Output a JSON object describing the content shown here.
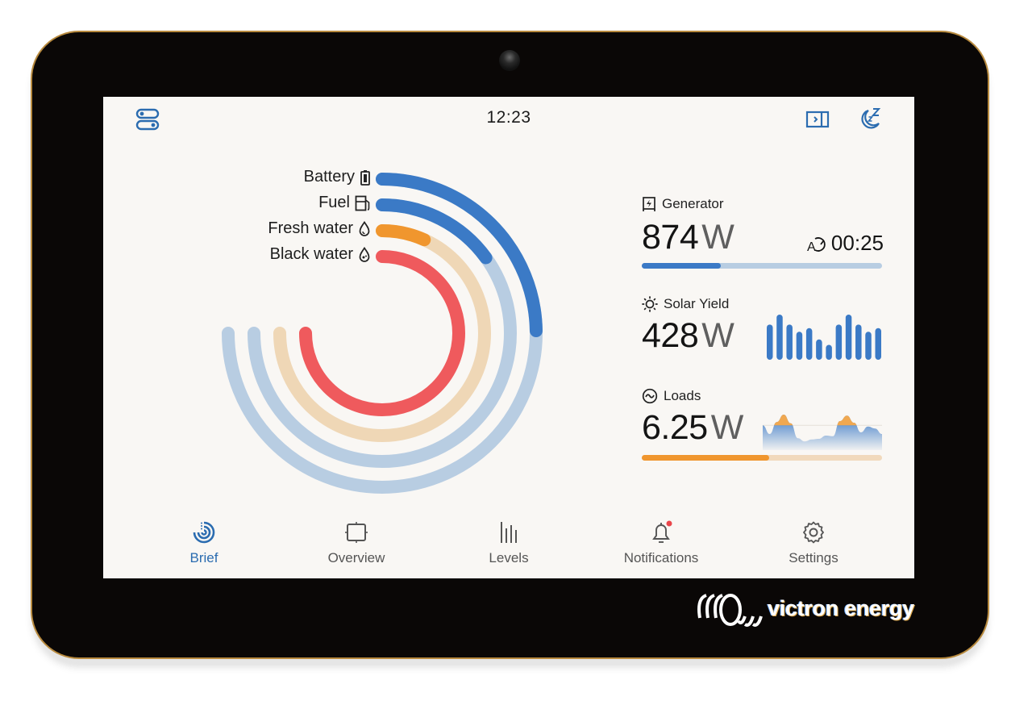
{
  "brand": {
    "name": "victron energy"
  },
  "header": {
    "time": "12:23",
    "left_icon": "toggles-icon",
    "right_icons": [
      "sidebar-toggle-icon",
      "sleep-moon-icon"
    ]
  },
  "levels": [
    {
      "label": "Battery",
      "icon": "battery-icon",
      "fraction": 0.33,
      "color": "#3b7ac6",
      "track": "#b8cde2"
    },
    {
      "label": "Fuel",
      "icon": "fuel-pump-icon",
      "fraction": 0.2,
      "color": "#3b7ac6",
      "track": "#b8cde2"
    },
    {
      "label": "Fresh water",
      "icon": "water-drop-icon",
      "fraction": 0.09,
      "color": "#f0962e",
      "track": "#efd7b6"
    },
    {
      "label": "Black water",
      "icon": "black-water-drop-icon",
      "fraction": 1.0,
      "color": "#ef5a5d",
      "track": "#f5b9ba"
    }
  ],
  "generator": {
    "title": "Generator",
    "icon": "generator-icon",
    "value": "874",
    "unit": "W",
    "autostart_icon": "auto-start-timer-icon",
    "runtime": "00:25",
    "progress": 0.33,
    "bar_color": "#3b7ac6",
    "track_color": "#b8cde2"
  },
  "solar": {
    "title": "Solar Yield",
    "icon": "sun-icon",
    "value": "428",
    "unit": "W",
    "bars": [
      0.78,
      1.0,
      0.78,
      0.62,
      0.7,
      0.45,
      0.33,
      0.78,
      1.0,
      0.78,
      0.62,
      0.7
    ],
    "bar_color": "#3b7ac6"
  },
  "loads": {
    "title": "Loads",
    "icon": "ac-wave-icon",
    "value": "6.25",
    "unit": "W",
    "progress": 0.53,
    "bar_color": "#f0962e",
    "track_color": "#f1d9bc",
    "sparkline": [
      0.62,
      0.35,
      0.72,
      0.95,
      0.68,
      0.22,
      0.12,
      0.18,
      0.2,
      0.3,
      0.28,
      0.75,
      0.92,
      0.7,
      0.4,
      0.58,
      0.52,
      0.35
    ],
    "threshold": 0.62,
    "area_color": "#3b7ac6",
    "peak_color": "#f0a850"
  },
  "nav": [
    {
      "label": "Brief",
      "icon": "brief-icon",
      "active": true
    },
    {
      "label": "Overview",
      "icon": "overview-icon",
      "active": false
    },
    {
      "label": "Levels",
      "icon": "levels-icon",
      "active": false
    },
    {
      "label": "Notifications",
      "icon": "bell-icon",
      "active": false,
      "badge": true
    },
    {
      "label": "Settings",
      "icon": "gear-icon",
      "active": false
    }
  ],
  "colors": {
    "accent": "#2b6cb0",
    "badge": "#e9454a"
  }
}
